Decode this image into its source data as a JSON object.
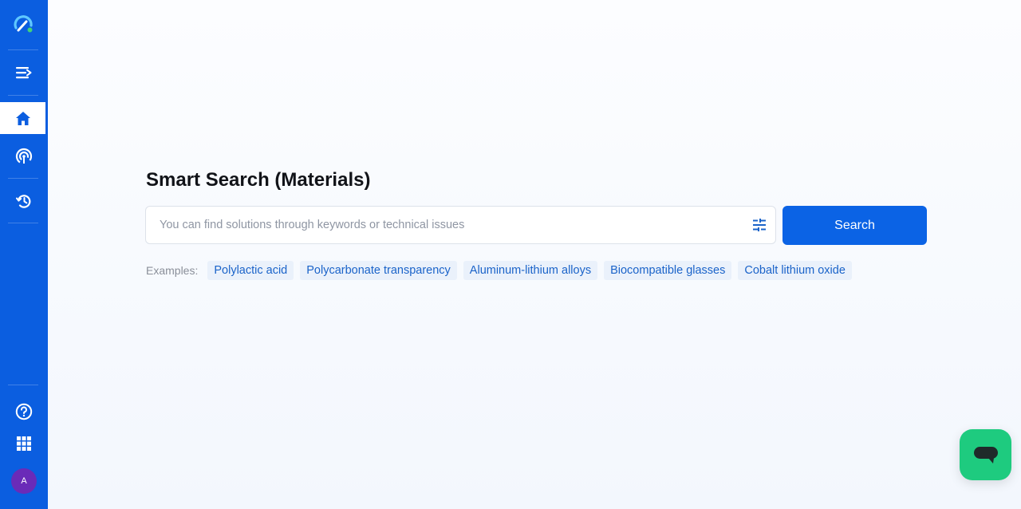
{
  "colors": {
    "sidebar": "#0b5ee0",
    "accent": "#0b63e5",
    "chip_bg": "#eaf1fb",
    "chip_text": "#1a63c9",
    "chat_fab": "#1ecb7f",
    "avatar": "#6a2bb8"
  },
  "sidebar": {
    "items": [
      {
        "name": "logo",
        "icon": "gauge-logo-icon"
      },
      {
        "name": "menu",
        "icon": "menu-arrow-icon"
      },
      {
        "name": "home",
        "icon": "home-icon",
        "active": true
      },
      {
        "name": "radar",
        "icon": "broadcast-icon"
      },
      {
        "name": "history",
        "icon": "history-icon"
      },
      {
        "name": "help",
        "icon": "help-circle-icon"
      },
      {
        "name": "apps",
        "icon": "grid-icon"
      }
    ],
    "avatar_initial": "A"
  },
  "main": {
    "title": "Smart Search (Materials)",
    "search": {
      "placeholder": "You can find solutions through keywords or technical issues",
      "value": "",
      "filter_icon": "filter-sliders-icon",
      "button_label": "Search"
    },
    "examples": {
      "label": "Examples:",
      "chips": [
        "Polylactic acid",
        "Polycarbonate transparency",
        "Aluminum-lithium alloys",
        "Biocompatible glasses",
        "Cobalt lithium oxide"
      ]
    }
  },
  "chat_widget": {
    "icon": "chat-bubble-icon"
  }
}
